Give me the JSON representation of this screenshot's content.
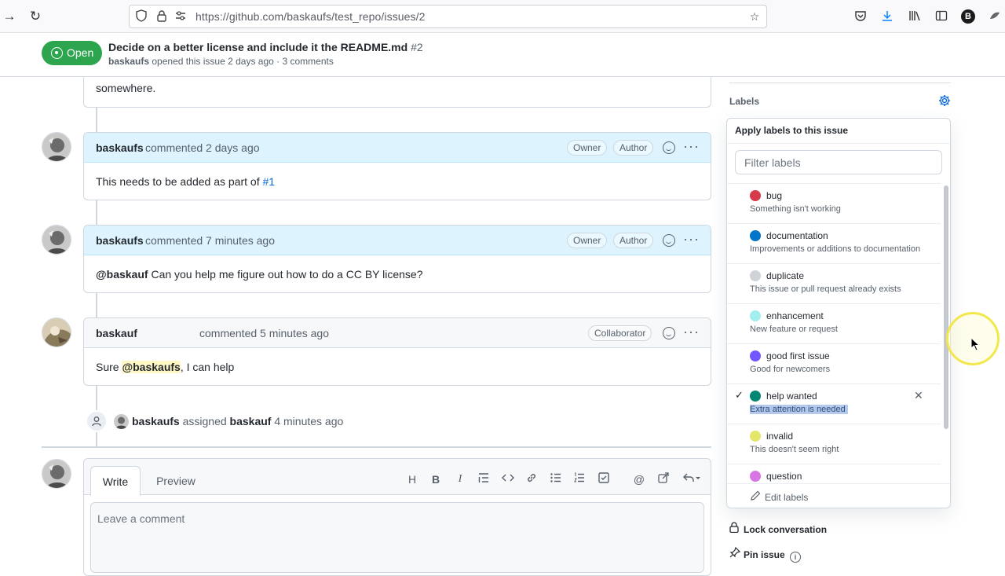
{
  "browser": {
    "url": "https://github.com/baskaufs/test_repo/issues/2",
    "profile_initial": "B"
  },
  "header": {
    "state": "Open",
    "title": "Decide on a better license and include it the README.md",
    "number": "#2",
    "author": "baskaufs",
    "meta": "opened this issue 2 days ago · 3 comments"
  },
  "top_fragment": "somewhere.",
  "comments": [
    {
      "author": "baskaufs",
      "when": "commented 2 days ago",
      "badges": [
        "Owner",
        "Author"
      ],
      "body_prefix": "This needs to be added as part of ",
      "body_link": "#1"
    },
    {
      "author": "baskaufs",
      "when": "commented 7 minutes ago",
      "badges": [
        "Owner",
        "Author"
      ],
      "body_mention": "@baskauf",
      "body_text": " Can you help me figure out how to do a CC BY license?"
    },
    {
      "author": "baskauf",
      "when": "commented 5 minutes ago",
      "badges": [
        "Collaborator"
      ],
      "body_prefix": "Sure ",
      "body_mention": "@baskaufs",
      "body_suffix": ", I can help"
    }
  ],
  "assign_event": {
    "actor": "baskaufs",
    "verb": "assigned",
    "assignee": "baskauf",
    "when": "4 minutes ago"
  },
  "new_comment": {
    "tab_write": "Write",
    "tab_preview": "Preview",
    "placeholder": "Leave a comment",
    "toolbar": [
      "H",
      "B",
      "I"
    ]
  },
  "sidebar": {
    "labels_heading": "Labels",
    "menu_title": "Apply labels to this issue",
    "filter_placeholder": "Filter labels",
    "labels": [
      {
        "name": "bug",
        "description": "Something isn't working",
        "color": "#d73a4a",
        "selected": false
      },
      {
        "name": "documentation",
        "description": "Improvements or additions to documentation",
        "color": "#0075ca",
        "selected": false
      },
      {
        "name": "duplicate",
        "description": "This issue or pull request already exists",
        "color": "#cfd3d7",
        "selected": false
      },
      {
        "name": "enhancement",
        "description": "New feature or request",
        "color": "#a2eeef",
        "selected": false
      },
      {
        "name": "good first issue",
        "description": "Good for newcomers",
        "color": "#7057ff",
        "selected": false
      },
      {
        "name": "help wanted",
        "description": "Extra attention is needed",
        "color": "#008672",
        "selected": true
      },
      {
        "name": "invalid",
        "description": "This doesn't seem right",
        "color": "#e4e669",
        "selected": false
      },
      {
        "name": "question",
        "description": "",
        "color": "#d876e3",
        "selected": false
      }
    ],
    "edit_labels": "Edit labels",
    "lock_conversation": "Lock conversation",
    "pin_issue": "Pin issue"
  }
}
